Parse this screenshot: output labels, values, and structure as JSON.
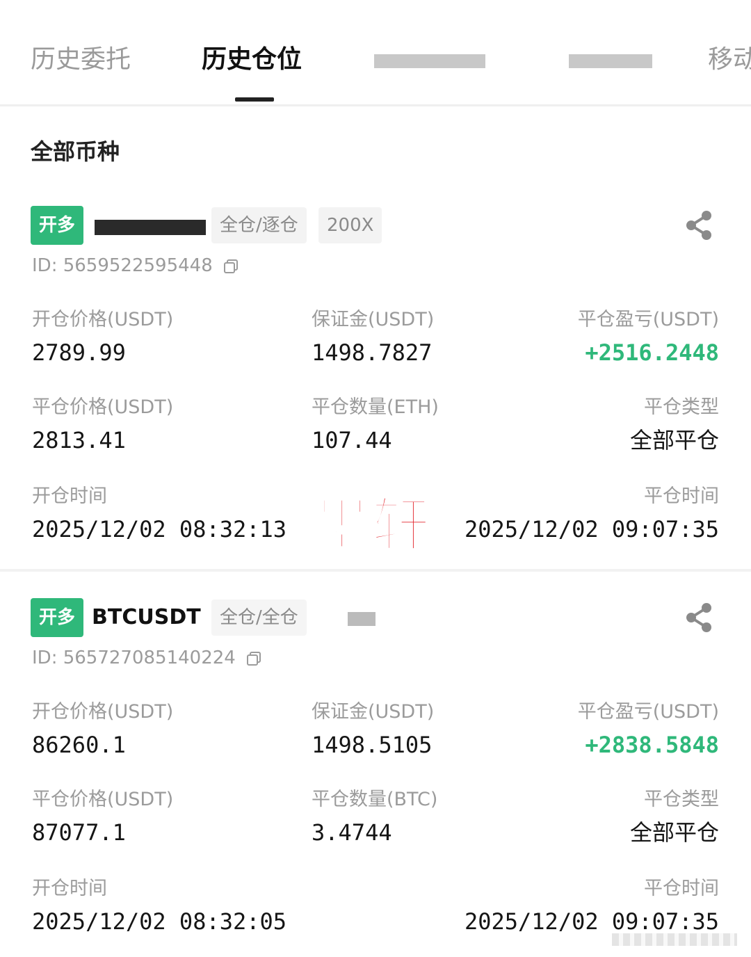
{
  "tabs": [
    {
      "label": "历史委托",
      "active": false
    },
    {
      "label": "历史仓位",
      "active": true
    },
    {
      "label": "",
      "active": false
    },
    {
      "label": "",
      "active": false
    },
    {
      "label": "移动",
      "active": false
    }
  ],
  "filter_label": "全部币种",
  "watermark": "墨轩",
  "colors": {
    "accent": "#2fb87a",
    "watermark": "#e11b22"
  },
  "positions": [
    {
      "side_badge": "开多",
      "symbol": "",
      "mode_tag": "全仓/逐仓",
      "leverage_tag": "200X",
      "id_text": "ID: 5659522595448",
      "open_price_label": "开仓价格(USDT)",
      "open_price": "2789.99",
      "margin_label": "保证金(USDT)",
      "margin": "1498.7827",
      "pnl_label": "平仓盈亏(USDT)",
      "pnl": "+2516.2448",
      "close_price_label": "平仓价格(USDT)",
      "close_price": "2813.41",
      "close_qty_label": "平仓数量(ETH)",
      "close_qty": "107.44",
      "close_type_label": "平仓类型",
      "close_type": "全部平仓",
      "open_time_label": "开仓时间",
      "open_time": "2025/12/02 08:32:13",
      "close_time_label": "平仓时间",
      "close_time": "2025/12/02 09:07:35"
    },
    {
      "side_badge": "开多",
      "symbol": "BTCUSDT",
      "mode_tag": "全仓/全仓",
      "leverage_tag": "",
      "id_text": "ID: 565727085140224",
      "open_price_label": "开仓价格(USDT)",
      "open_price": "86260.1",
      "margin_label": "保证金(USDT)",
      "margin": "1498.5105",
      "pnl_label": "平仓盈亏(USDT)",
      "pnl": "+2838.5848",
      "close_price_label": "平仓价格(USDT)",
      "close_price": "87077.1",
      "close_qty_label": "平仓数量(BTC)",
      "close_qty": "3.4744",
      "close_type_label": "平仓类型",
      "close_type": "全部平仓",
      "open_time_label": "开仓时间",
      "open_time": "2025/12/02 08:32:05",
      "close_time_label": "平仓时间",
      "close_time": "2025/12/02 09:07:35"
    }
  ]
}
